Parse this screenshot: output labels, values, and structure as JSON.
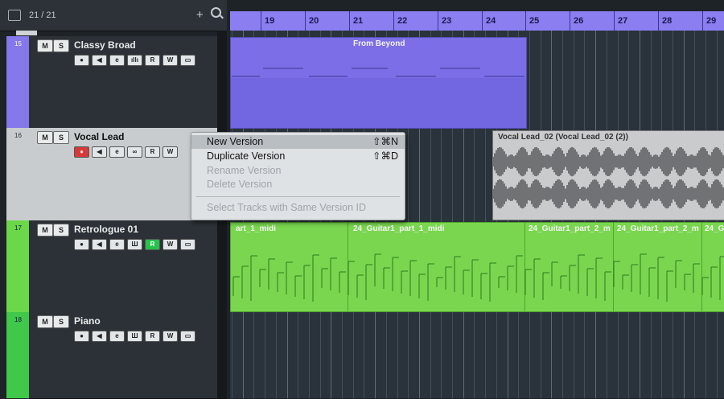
{
  "header": {
    "count": "21 / 21",
    "add": "+"
  },
  "ruler": {
    "bars": [
      "19",
      "20",
      "21",
      "22",
      "23",
      "24",
      "25",
      "26",
      "27",
      "28",
      "29"
    ]
  },
  "tracks": [
    {
      "num": "15",
      "name": "Classy Broad",
      "color": "#8478ea"
    },
    {
      "num": "16",
      "name": "Vocal Lead",
      "color": "#c8cccf"
    },
    {
      "num": "17",
      "name": "Retrologue 01",
      "color": "#6bd84a"
    },
    {
      "num": "18",
      "name": "Piano",
      "color": "#3fc84a"
    }
  ],
  "buttons": {
    "mute": "M",
    "solo": "S",
    "read": "R",
    "write": "W",
    "edit": "e"
  },
  "parts": {
    "classy_label": "From Beyond",
    "vocal_label": "Vocal Lead_02 (Vocal Lead_02 (2))",
    "retro1": "art_1_midi",
    "retro2": "24_Guitar1_part_1_midi",
    "retro3": "24_Guitar1_part_2_m",
    "retro4": "24_Guitar1_part_2_m",
    "retro5": "24_G"
  },
  "context_menu": {
    "items": [
      {
        "label": "New Version",
        "shortcut": "⇧⌘N"
      },
      {
        "label": "Duplicate Version",
        "shortcut": "⇧⌘D"
      },
      {
        "label": "Rename Version",
        "shortcut": ""
      },
      {
        "label": "Delete Version",
        "shortcut": ""
      },
      {
        "label": "Select Tracks with Same Version ID",
        "shortcut": ""
      }
    ]
  },
  "colors": {
    "ruler": "#8a7ef0",
    "midi_purple": "#7b6ee6",
    "midi_green": "#7ad64f",
    "audio_bg": "#c9cbcd"
  }
}
